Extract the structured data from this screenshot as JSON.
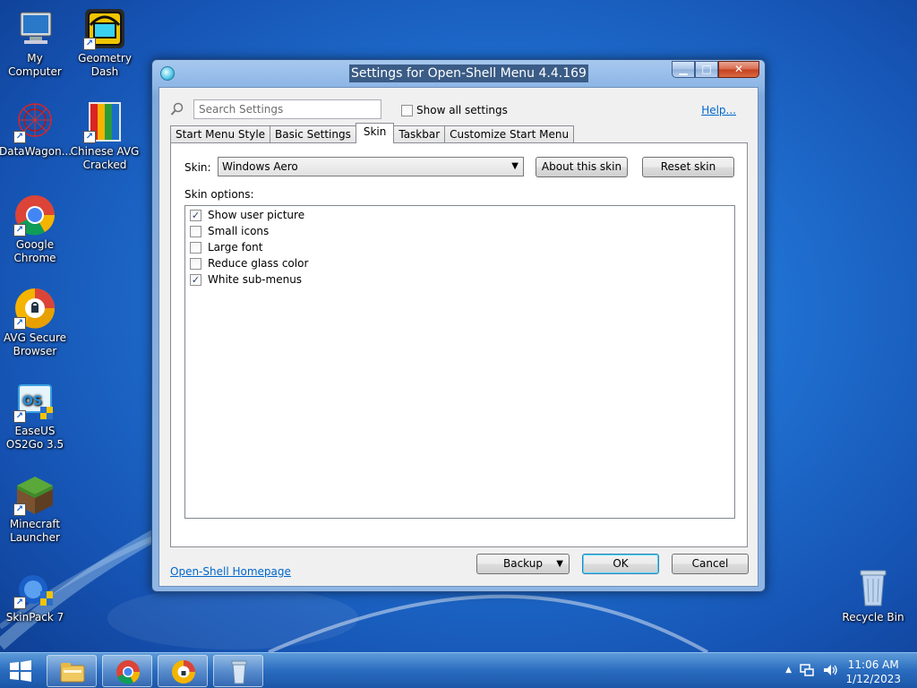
{
  "desktop": {
    "icons": [
      {
        "label": "My Computer"
      },
      {
        "label": "Geometry Dash"
      },
      {
        "label": "DataWagon..."
      },
      {
        "label": "Chinese AVG Cracked"
      },
      {
        "label": "Google Chrome"
      },
      {
        "label": "AVG Secure Browser"
      },
      {
        "label": "EaseUS OS2Go 3.5"
      },
      {
        "label": "Minecraft Launcher"
      },
      {
        "label": "SkinPack 7"
      }
    ],
    "recycle_bin": {
      "label": "Recycle Bin"
    }
  },
  "window": {
    "title": "Settings for Open-Shell Menu 4.4.169",
    "controls": {
      "minimize": "▁",
      "maximize": "□",
      "close": "✕"
    }
  },
  "search": {
    "placeholder": "Search Settings"
  },
  "show_all": {
    "label": "Show all settings",
    "checked": false
  },
  "help_link": "Help...",
  "tabs": [
    {
      "label": "Start Menu Style",
      "active": false
    },
    {
      "label": "Basic Settings",
      "active": false
    },
    {
      "label": "Skin",
      "active": true
    },
    {
      "label": "Taskbar",
      "active": false
    },
    {
      "label": "Customize Start Menu",
      "active": false
    }
  ],
  "skin": {
    "label": "Skin:",
    "selected": "Windows Aero",
    "about_button": "About this skin",
    "reset_button": "Reset skin",
    "options_label": "Skin options:",
    "options": [
      {
        "label": "Show user picture",
        "checked": true
      },
      {
        "label": "Small icons",
        "checked": false
      },
      {
        "label": "Large font",
        "checked": false
      },
      {
        "label": "Reduce glass color",
        "checked": false
      },
      {
        "label": "White sub-menus",
        "checked": true
      }
    ]
  },
  "footer": {
    "homepage_link": "Open-Shell Homepage",
    "backup_button": "Backup",
    "ok_button": "OK",
    "cancel_button": "Cancel"
  },
  "taskbar": {
    "clock_time": "11:06 AM",
    "clock_date": "1/12/2023"
  }
}
